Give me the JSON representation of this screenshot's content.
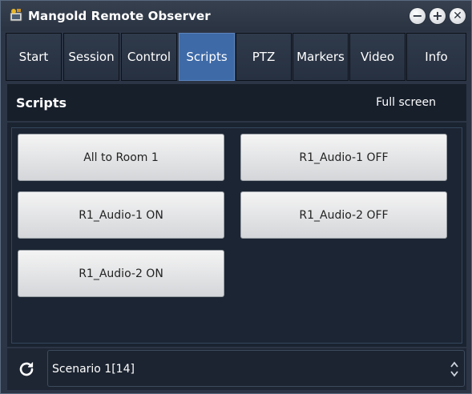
{
  "window": {
    "title": "Mangold Remote Observer"
  },
  "window_controls": [
    "minimize",
    "maximize",
    "close"
  ],
  "tabs": [
    {
      "label": "Start",
      "active": false
    },
    {
      "label": "Session",
      "active": false
    },
    {
      "label": "Control",
      "active": false
    },
    {
      "label": "Scripts",
      "active": true
    },
    {
      "label": "PTZ",
      "active": false
    },
    {
      "label": "Markers",
      "active": false
    },
    {
      "label": "Video",
      "active": false
    },
    {
      "label": "Info",
      "active": false
    }
  ],
  "header": {
    "title": "Scripts",
    "fullscreen_label": "Full screen"
  },
  "scripts": [
    {
      "label": "All to Room 1"
    },
    {
      "label": "R1_Audio-1 OFF"
    },
    {
      "label": "R1_Audio-1 ON"
    },
    {
      "label": "R1_Audio-2 OFF"
    },
    {
      "label": "R1_Audio-2 ON"
    }
  ],
  "footer": {
    "scenario_value": "Scenario 1[14]",
    "refresh_icon": "refresh-icon"
  },
  "colors": {
    "active_tab": "#3e6aa7",
    "background": "#2c3545"
  }
}
